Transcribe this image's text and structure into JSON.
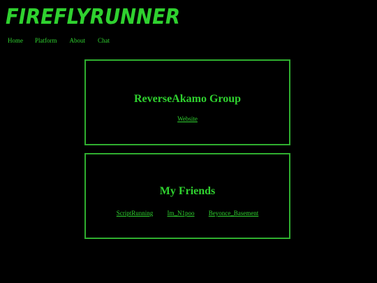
{
  "site": {
    "logo_text": "FIREFLYRUNNER",
    "accent_color": "#2fd12f",
    "border_color": "#2fae2f",
    "background_color": "#000000"
  },
  "nav": {
    "items": [
      {
        "label": "Home"
      },
      {
        "label": "Platform"
      },
      {
        "label": "About"
      },
      {
        "label": "Chat"
      }
    ]
  },
  "group_card": {
    "title": "ReverseAkamo Group",
    "links": [
      {
        "label": "Website"
      }
    ]
  },
  "friends_card": {
    "title": "My Friends",
    "links": [
      {
        "label": "ScriptRunning"
      },
      {
        "label": "Im_N1poo"
      },
      {
        "label": "Beyonce_Basement"
      }
    ]
  }
}
